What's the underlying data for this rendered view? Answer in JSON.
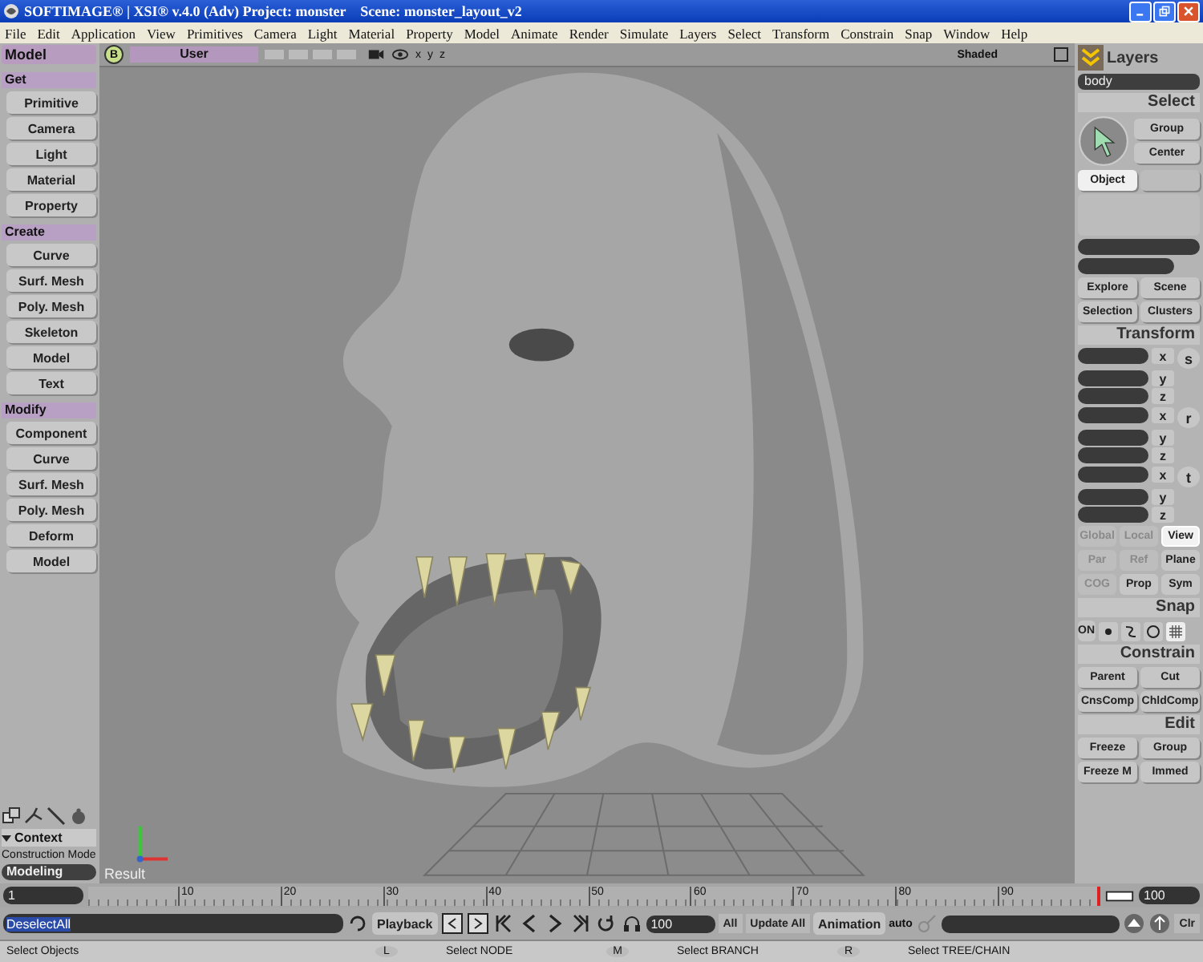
{
  "window": {
    "title": "SOFTIMAGE® | XSI® v.4.0 (Adv) Project: monster    Scene: monster_layout_v2"
  },
  "menu": [
    "File",
    "Edit",
    "Application",
    "View",
    "Primitives",
    "Camera",
    "Light",
    "Material",
    "Property",
    "Model",
    "Animate",
    "Render",
    "Simulate",
    "Layers",
    "Select",
    "Transform",
    "Constrain",
    "Snap",
    "Window",
    "Help"
  ],
  "viewport": {
    "badge": "B",
    "camera": "User",
    "axes": [
      "x",
      "y",
      "z"
    ],
    "shading": "Shaded",
    "label": "Result"
  },
  "left_panel": {
    "title": "Model",
    "sections": [
      {
        "title": "Get",
        "buttons": [
          "Primitive",
          "Camera",
          "Light",
          "Material",
          "Property"
        ]
      },
      {
        "title": "Create",
        "buttons": [
          "Curve",
          "Surf. Mesh",
          "Poly. Mesh",
          "Skeleton",
          "Model",
          "Text"
        ]
      },
      {
        "title": "Modify",
        "buttons": [
          "Component",
          "Curve",
          "Surf. Mesh",
          "Poly. Mesh",
          "Deform",
          "Model"
        ]
      }
    ],
    "context": {
      "title": "Context",
      "expanded": true,
      "mode_label": "Construction Mode",
      "mode": "Modeling"
    }
  },
  "right_panel": {
    "layers_title": "Layers",
    "layer": "body",
    "select": {
      "title": "Select",
      "buttons": [
        {
          "label": "Group",
          "selected": false
        },
        {
          "label": "Center",
          "selected": false
        },
        {
          "label": "Object",
          "selected": true
        }
      ],
      "views": [
        "Explore",
        "Scene",
        "Selection",
        "Clusters"
      ]
    },
    "transform": {
      "title": "Transform",
      "groups": [
        {
          "key": "s",
          "axes": [
            "x",
            "y",
            "z"
          ]
        },
        {
          "key": "r",
          "axes": [
            "x",
            "y",
            "z"
          ]
        },
        {
          "key": "t",
          "axes": [
            "x",
            "y",
            "z"
          ]
        }
      ],
      "refs": [
        {
          "label": "Global",
          "selected": false,
          "disabled": true
        },
        {
          "label": "Local",
          "selected": false,
          "disabled": true
        },
        {
          "label": "View",
          "selected": true,
          "disabled": false
        },
        {
          "label": "Par",
          "selected": false,
          "disabled": true
        },
        {
          "label": "Ref",
          "selected": false,
          "disabled": true
        },
        {
          "label": "Plane",
          "selected": false,
          "disabled": false
        },
        {
          "label": "COG",
          "selected": false,
          "disabled": true
        },
        {
          "label": "Prop",
          "selected": false,
          "disabled": false
        },
        {
          "label": "Sym",
          "selected": false,
          "disabled": false
        }
      ]
    },
    "snap": {
      "title": "Snap",
      "toggle": "ON"
    },
    "constrain": {
      "title": "Constrain",
      "buttons": [
        "Parent",
        "Cut",
        "CnsComp",
        "ChldComp"
      ]
    },
    "edit": {
      "title": "Edit",
      "buttons": [
        "Freeze",
        "Group",
        "Freeze M",
        "Immed"
      ]
    }
  },
  "timeline": {
    "start": "1",
    "ticks": [
      "10",
      "20",
      "30",
      "40",
      "50",
      "60",
      "70",
      "80",
      "90"
    ],
    "end": "100"
  },
  "command": {
    "value": "DeselectAll",
    "playback": "Playback",
    "frame": "100",
    "all": "All",
    "update": "Update All",
    "animation": "Animation",
    "auto": "auto",
    "clear": "Clr"
  },
  "status_bar": {
    "hint": "Select Objects",
    "mouse": [
      {
        "key": "L",
        "action": "Select NODE"
      },
      {
        "key": "M",
        "action": "Select BRANCH"
      },
      {
        "key": "R",
        "action": "Select TREE/CHAIN"
      }
    ]
  }
}
